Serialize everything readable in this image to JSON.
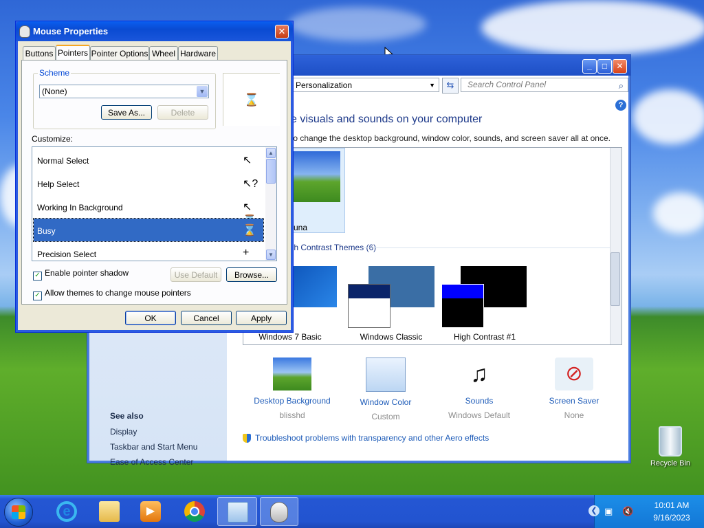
{
  "mouse_dialog": {
    "title": "Mouse Properties",
    "close": "✕",
    "tabs": [
      "Buttons",
      "Pointers",
      "Pointer Options",
      "Wheel",
      "Hardware"
    ],
    "active_tab": "Pointers",
    "scheme_label": "Scheme",
    "scheme_value": "(None)",
    "save_as": "Save As...",
    "delete": "Delete",
    "customize_label": "Customize:",
    "pointers": [
      {
        "label": "Normal Select",
        "glyph": "↖"
      },
      {
        "label": "Help Select",
        "glyph": "↖?"
      },
      {
        "label": "Working In Background",
        "glyph": "↖⌛"
      },
      {
        "label": "Busy",
        "glyph": "⌛"
      },
      {
        "label": "Precision Select",
        "glyph": "+"
      }
    ],
    "selected_pointer": "Busy",
    "preview_glyph": "⌛",
    "enable_shadow": "Enable pointer shadow",
    "allow_themes": "Allow themes to change mouse pointers",
    "use_default": "Use Default",
    "browse": "Browse...",
    "ok": "OK",
    "cancel": "Cancel",
    "apply": "Apply"
  },
  "control_panel": {
    "address": "Personalization",
    "search_placeholder": "Search Control Panel",
    "help": "?",
    "heading": "e visuals and sounds on your computer",
    "subheading": "to change the desktop background, window color, sounds, and screen saver all at once.",
    "luna_label": "una",
    "hc_group": "igh Contrast Themes (6)",
    "themes": [
      "Windows 7 Basic",
      "Windows Classic",
      "High Contrast #1"
    ],
    "settings": [
      {
        "label": "Desktop Background",
        "sub": "blisshd"
      },
      {
        "label": "Window Color",
        "sub": "Custom"
      },
      {
        "label": "Sounds",
        "sub": "Windows Default"
      },
      {
        "label": "Screen Saver",
        "sub": "None"
      }
    ],
    "troubleshoot": "Troubleshoot problems with transparency and other Aero effects",
    "see_also": {
      "heading": "See also",
      "links": [
        "Display",
        "Taskbar and Start Menu",
        "Ease of Access Center"
      ]
    }
  },
  "desktop": {
    "recycle_bin": "Recycle Bin"
  },
  "taskbar": {
    "time": "10:01 AM",
    "date": "9/16/2023"
  }
}
